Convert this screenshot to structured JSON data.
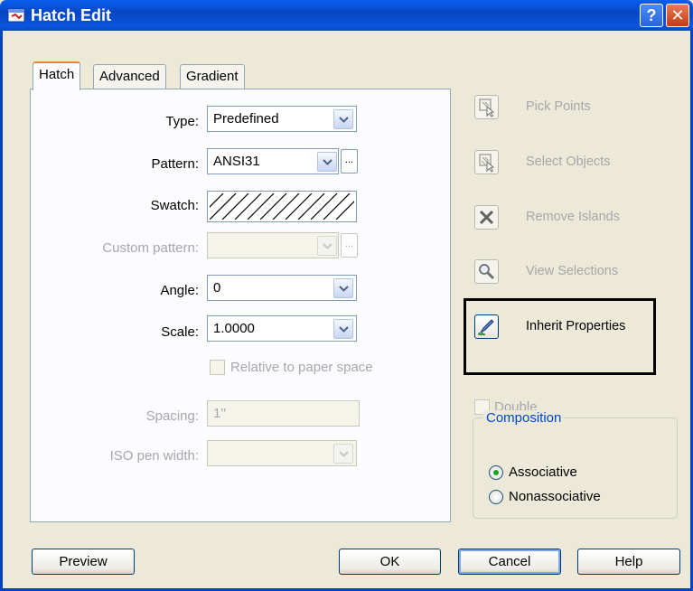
{
  "window": {
    "title": "Hatch Edit",
    "help_glyph": "?",
    "close_glyph": "✕",
    "titlebar_color": "#0a55e0"
  },
  "tabs": [
    {
      "label": "Hatch",
      "active": true
    },
    {
      "label": "Advanced",
      "active": false
    },
    {
      "label": "Gradient",
      "active": false
    }
  ],
  "hatch": {
    "type": {
      "label": "Type:",
      "value": "Predefined"
    },
    "pattern": {
      "label": "Pattern:",
      "value": "ANSI31",
      "browse": "..."
    },
    "swatch": {
      "label": "Swatch:"
    },
    "custom_pattern": {
      "label": "Custom pattern:",
      "value": "",
      "browse": "..."
    },
    "angle": {
      "label": "Angle:",
      "value": "0"
    },
    "scale": {
      "label": "Scale:",
      "value": "1.0000"
    },
    "relative_paper_space": {
      "label": "Relative to paper space",
      "checked": false
    },
    "spacing": {
      "label": "Spacing:",
      "value": "1''"
    },
    "iso_pen_width": {
      "label": "ISO pen width:",
      "value": ""
    }
  },
  "side": {
    "pick_points": {
      "label": "Pick Points",
      "icon": "pick-points-icon"
    },
    "select_objects": {
      "label": "Select Objects",
      "icon": "select-objects-icon"
    },
    "remove_islands": {
      "label": "Remove Islands",
      "icon": "remove-islands-icon"
    },
    "view_selections": {
      "label": "View Selections",
      "icon": "magnifier-icon"
    },
    "inherit_properties": {
      "label": "Inherit Properties",
      "icon": "paintbrush-icon"
    },
    "double": {
      "label": "Double",
      "checked": false
    }
  },
  "composition": {
    "title": "Composition",
    "options": [
      {
        "label": "Associative",
        "selected": true
      },
      {
        "label": "Nonassociative",
        "selected": false
      }
    ]
  },
  "buttons": {
    "preview": "Preview",
    "ok": "OK",
    "cancel": "Cancel",
    "help": "Help"
  }
}
